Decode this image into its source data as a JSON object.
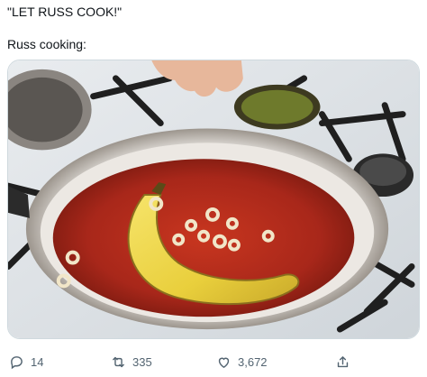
{
  "tweet": {
    "line1": "\"LET RUSS COOK!\"",
    "line2": "Russ cooking:"
  },
  "media": {
    "description_icon": "photo"
  },
  "actions": {
    "reply_count": "14",
    "retweet_count": "335",
    "like_count": "3,672"
  },
  "colors": {
    "text": "#0f1419",
    "muted": "#536471",
    "border": "#cfd9de"
  }
}
